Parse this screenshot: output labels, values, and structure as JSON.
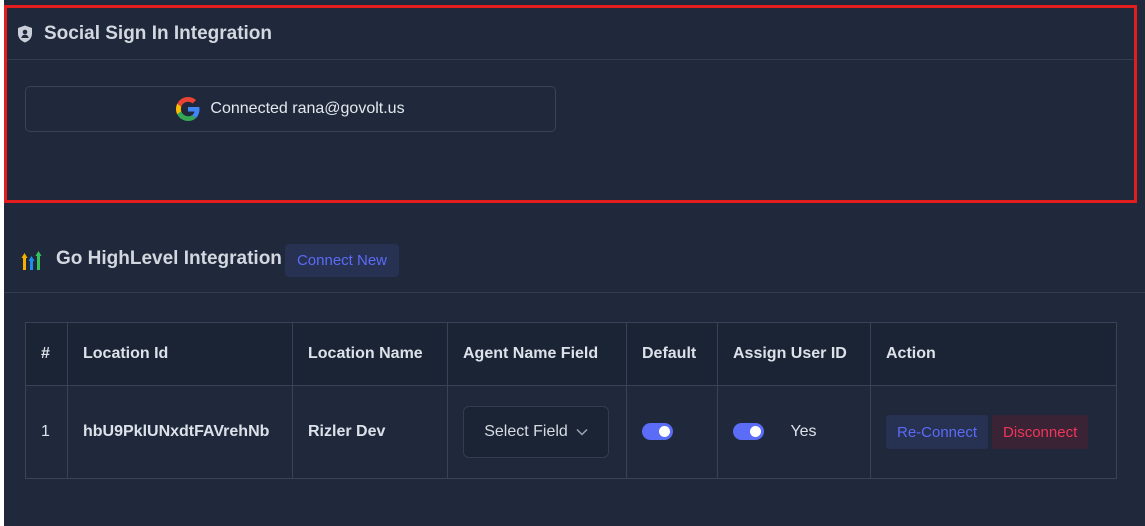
{
  "social": {
    "title": "Social Sign In Integration",
    "icon": "shield-icon",
    "connected_label": "Connected rana@govolt.us",
    "provider_icon": "google-icon"
  },
  "ghl": {
    "title": "Go HighLevel Integration",
    "icon": "ghl-logo-icon",
    "connect_new_label": "Connect New",
    "columns": [
      "#",
      "Location Id",
      "Location Name",
      "Agent Name Field",
      "Default",
      "Assign User ID",
      "Action"
    ],
    "rows": [
      {
        "index": "1",
        "location_id": "hbU9PklUNxdtFAVrehNb",
        "location_name": "Rizler Dev",
        "agent_field_placeholder": "Select Field",
        "default_on": true,
        "assign_user_on": true,
        "assign_user_label": "Yes",
        "reconnect_label": "Re-Connect",
        "disconnect_label": "Disconnect"
      }
    ]
  },
  "colors": {
    "background": "#1f293b",
    "accent": "#5b6cf7",
    "danger": "#f0365a",
    "highlight_border": "#e21d1d"
  }
}
